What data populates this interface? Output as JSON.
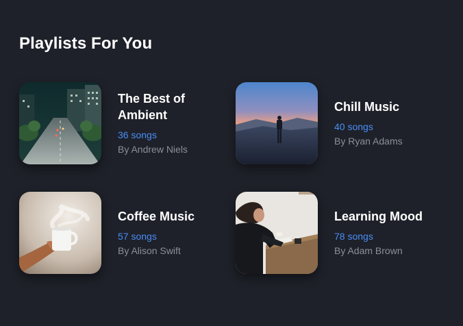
{
  "section": {
    "title": "Playlists For You"
  },
  "playlists": [
    {
      "title": "The Best of Ambient",
      "songs": "36 songs",
      "author": "By Andrew Niels",
      "cover": "night-city-street-photo"
    },
    {
      "title": "Chill Music",
      "songs": "40 songs",
      "author": "By Ryan Adams",
      "cover": "sunset-silhouette-photo"
    },
    {
      "title": "Coffee Music",
      "songs": "57 songs",
      "author": "By Alison Swift",
      "cover": "coffee-cup-photo"
    },
    {
      "title": "Learning Mood",
      "songs": "78 songs",
      "author": "By Adam Brown",
      "cover": "person-reading-photo"
    }
  ],
  "colors": {
    "background": "#1e2129",
    "accent": "#4a8df6",
    "muted_text": "#8c8f98",
    "primary_text": "#ffffff"
  }
}
